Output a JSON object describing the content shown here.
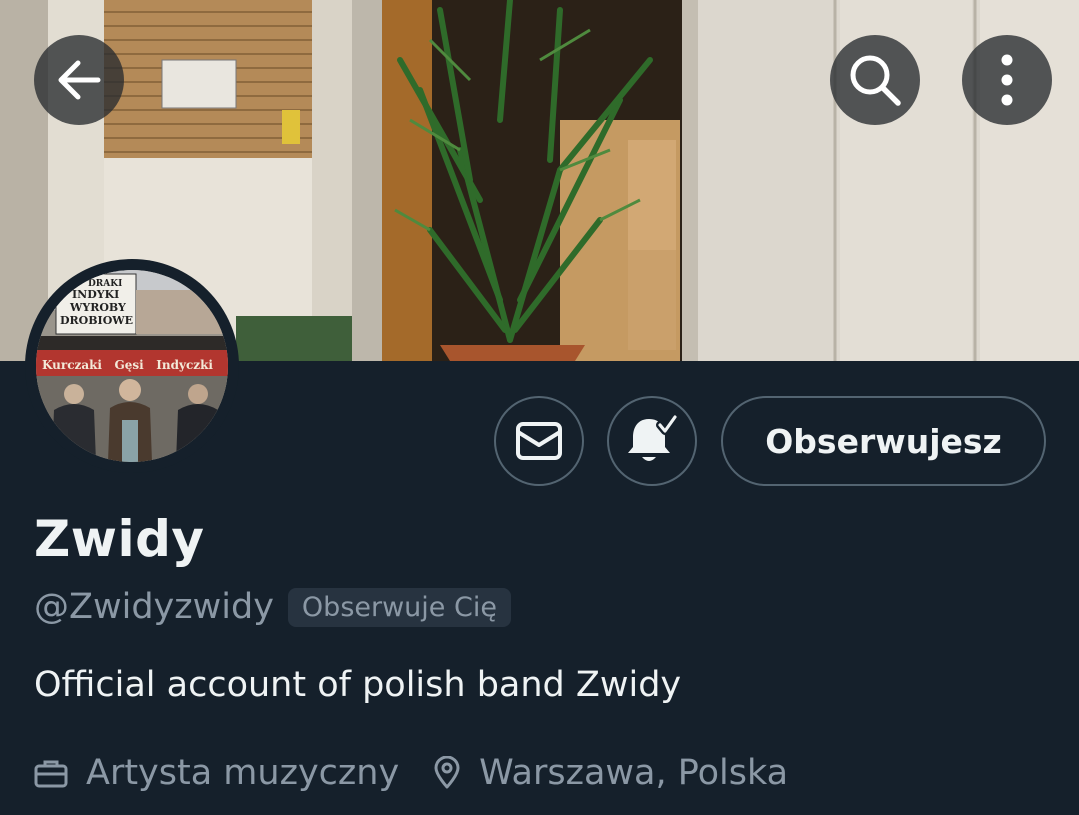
{
  "profile": {
    "display_name": "Zwidy",
    "handle": "@Zwidyzwidy",
    "follows_you_badge": "Obserwuje Cię",
    "bio": "Official account of polish band Zwidy",
    "category": "Artysta muzyczny",
    "location": "Warszawa, Polska"
  },
  "actions": {
    "follow_label": "Obserwujesz",
    "message_icon": "envelope-icon",
    "notifications_icon": "bell-check-icon"
  },
  "header_controls": {
    "back_icon": "arrow-left-icon",
    "search_icon": "search-icon",
    "more_icon": "more-vertical-icon"
  },
  "avatar_photo": {
    "sign_top": [
      "DRAKI",
      "INDYKI",
      "WYROBY",
      "DROBIOWE"
    ],
    "sign_bottom": "Kurczaki   Gęsi   Indyczki"
  },
  "colors": {
    "background": "#15202b",
    "text_primary": "#eff3f4",
    "text_secondary": "#8b98a5",
    "border": "#536471",
    "badge_bg": "#273340"
  }
}
